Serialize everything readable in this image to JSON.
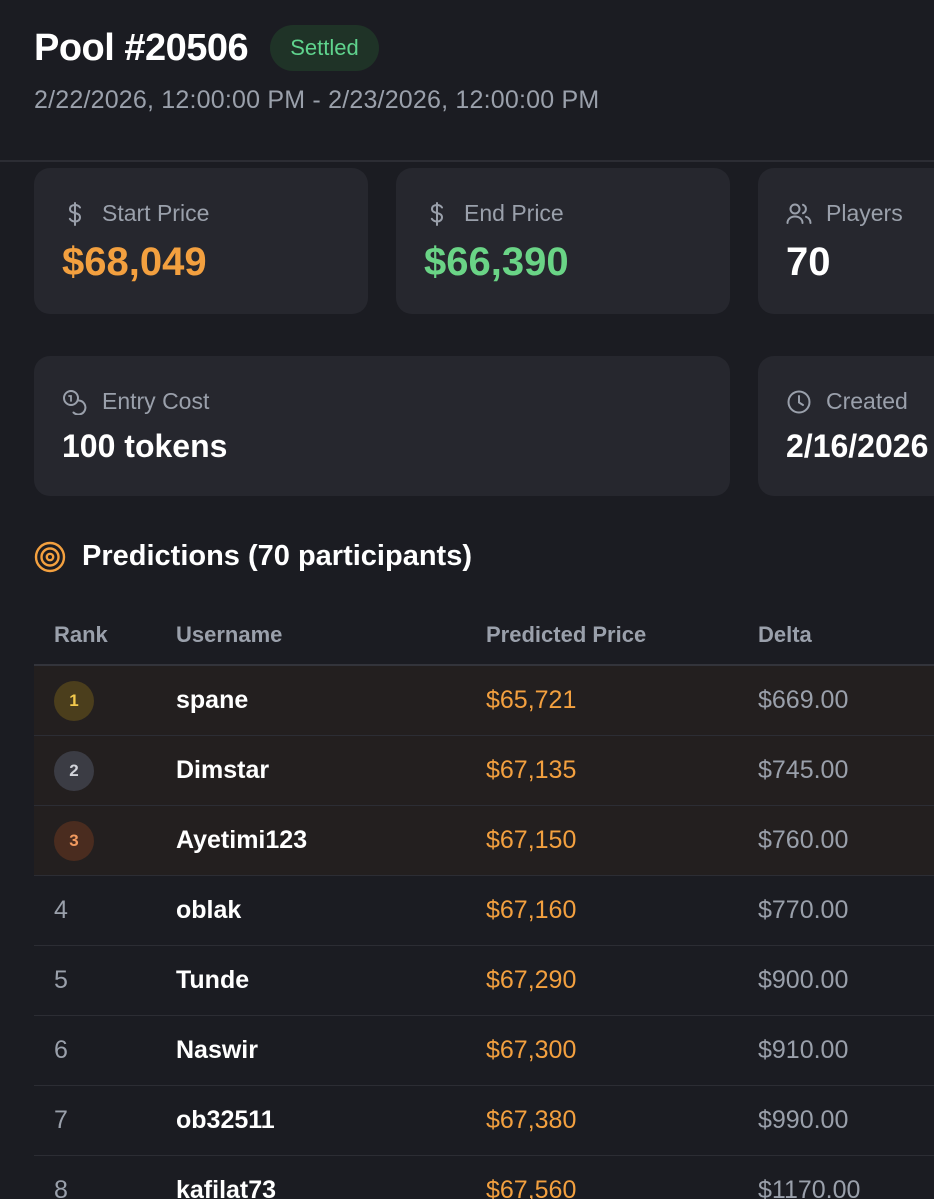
{
  "header": {
    "title": "Pool #20506",
    "status": "Settled",
    "date_range": "2/22/2026, 12:00:00 PM - 2/23/2026, 12:00:00 PM"
  },
  "stats": {
    "start_price": {
      "label": "Start Price",
      "value": "$68,049",
      "icon": "dollar-icon"
    },
    "end_price": {
      "label": "End Price",
      "value": "$66,390",
      "icon": "dollar-icon"
    },
    "players": {
      "label": "Players",
      "value": "70",
      "icon": "users-icon"
    },
    "entry_cost": {
      "label": "Entry Cost",
      "value": "100 tokens",
      "icon": "coins-icon"
    },
    "created": {
      "label": "Created",
      "value": "2/16/2026",
      "icon": "clock-icon"
    }
  },
  "predictions": {
    "heading": "Predictions (70 participants)",
    "icon": "target-icon",
    "columns": [
      "Rank",
      "Username",
      "Predicted Price",
      "Delta"
    ],
    "rows": [
      {
        "rank": "1",
        "username": "spane",
        "predicted": "$65,721",
        "delta": "$669.00"
      },
      {
        "rank": "2",
        "username": "Dimstar",
        "predicted": "$67,135",
        "delta": "$745.00"
      },
      {
        "rank": "3",
        "username": "Ayetimi123",
        "predicted": "$67,150",
        "delta": "$760.00"
      },
      {
        "rank": "4",
        "username": "oblak",
        "predicted": "$67,160",
        "delta": "$770.00"
      },
      {
        "rank": "5",
        "username": "Tunde",
        "predicted": "$67,290",
        "delta": "$900.00"
      },
      {
        "rank": "6",
        "username": "Naswir",
        "predicted": "$67,300",
        "delta": "$910.00"
      },
      {
        "rank": "7",
        "username": "ob32511",
        "predicted": "$67,380",
        "delta": "$990.00"
      },
      {
        "rank": "8",
        "username": "kafilat73",
        "predicted": "$67,560",
        "delta": "$1170.00"
      }
    ]
  },
  "colors": {
    "background": "#1b1c22",
    "card": "#26272e",
    "accent_orange": "#f3a03f",
    "accent_green": "#6ad486",
    "muted_text": "#9aa0ab"
  }
}
